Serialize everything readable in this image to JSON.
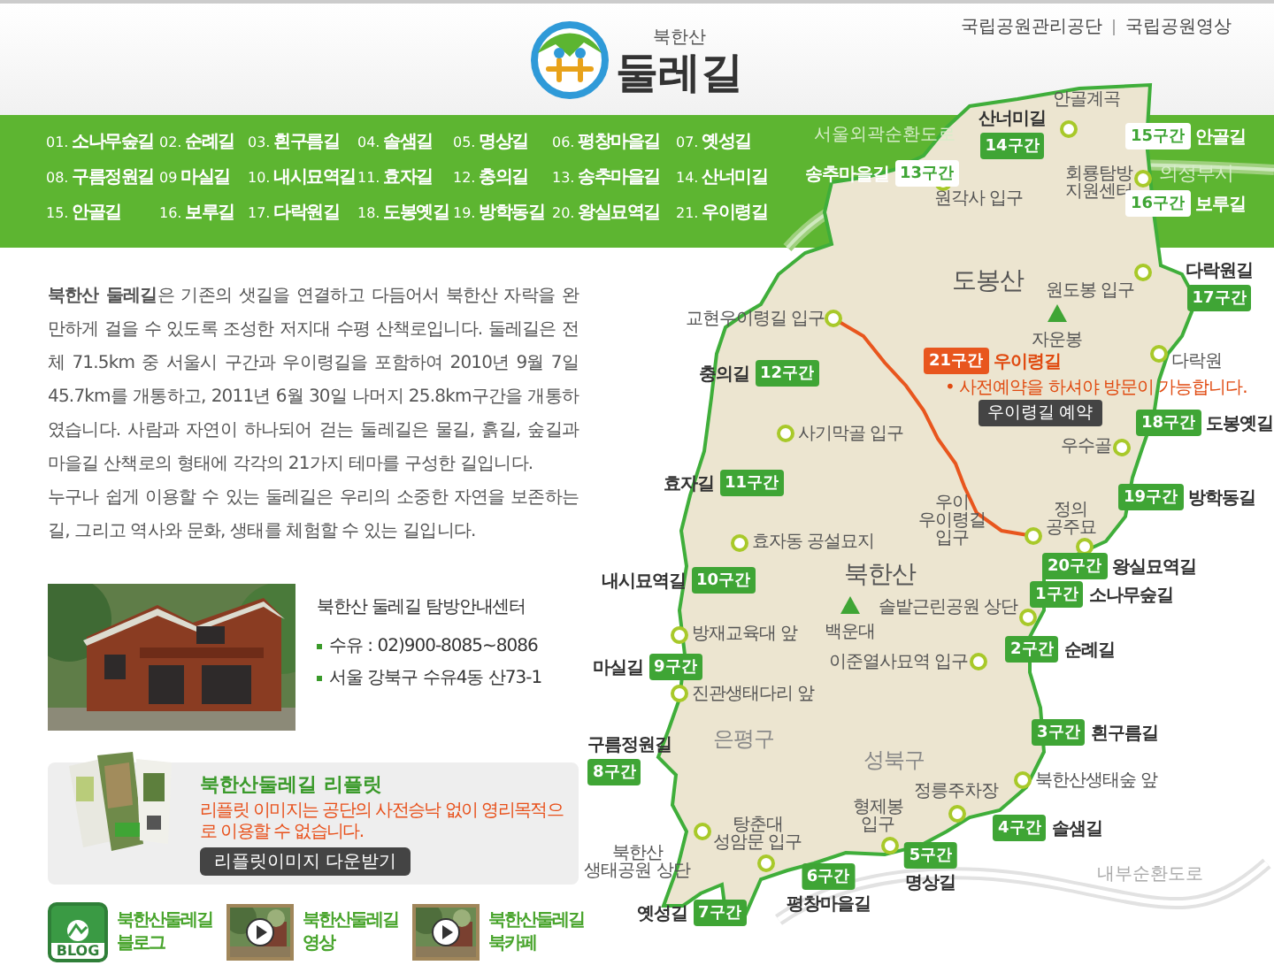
{
  "header": {
    "logo_small": "북한산",
    "logo_main": "둘레길",
    "links": [
      "국립공원관리공단",
      "국립공원영상"
    ]
  },
  "nav": [
    {
      "num": "01.",
      "name": "소나무숲길"
    },
    {
      "num": "02.",
      "name": "순례길"
    },
    {
      "num": "03.",
      "name": "흰구름길"
    },
    {
      "num": "04.",
      "name": "솔샘길"
    },
    {
      "num": "05.",
      "name": "명상길"
    },
    {
      "num": "06.",
      "name": "평창마을길"
    },
    {
      "num": "07.",
      "name": "옛성길"
    },
    {
      "num": "08.",
      "name": "구름정원길"
    },
    {
      "num": "09",
      "name": "마실길"
    },
    {
      "num": "10.",
      "name": "내시묘역길"
    },
    {
      "num": "11.",
      "name": "효자길"
    },
    {
      "num": "12.",
      "name": "충의길"
    },
    {
      "num": "13.",
      "name": "송추마을길"
    },
    {
      "num": "14.",
      "name": "산너미길"
    },
    {
      "num": "15.",
      "name": "안골길"
    },
    {
      "num": "16.",
      "name": "보루길"
    },
    {
      "num": "17.",
      "name": "다락원길"
    },
    {
      "num": "18.",
      "name": "도봉옛길"
    },
    {
      "num": "19.",
      "name": "방학동길"
    },
    {
      "num": "20.",
      "name": "왕실묘역길"
    },
    {
      "num": "21.",
      "name": "우이령길"
    }
  ],
  "intro": {
    "paragraphs": [
      "**북한산 둘레길**은 기존의 샛길을 연결하고 다듬어서 북한산 자락을 완만하게 걸을 수 있도록 조성한 저지대 수평 산책로입니다. 둘레길은 전체 71.5km 중 서울시 구간과 우이령길을 포함하여 2010년 9월 7일 45.7km를 개통하고, 2011년 6월 30일 나머지 25.8km구간을 개통하였습니다. 사람과 자연이 하나되어 걷는 둘레길은 물길, 흙길, 숲길과 마을길 산책로의 형태에 각각의 21가지 테마를 구성한 길입니다.",
      "누구나 쉽게 이용할 수 있는 둘레길은 우리의 소중한 자연을 보존하는 길, 그리고 역사와 문화, 생태를 체험할 수 있는 길입니다."
    ]
  },
  "center": {
    "title": "북한산 둘레길 탐방안내센터",
    "details": [
      "수유 : 02)900-8085~8086",
      "서울 강북구 수유4동 산73-1"
    ]
  },
  "leaflet": {
    "title": "북한산둘레길 리플릿",
    "notice": "리플릿 이미지는 공단의 사전승낙 없이 영리목적으로 이용할 수 없습니다.",
    "button": "리플릿이미지 다운받기"
  },
  "links": [
    {
      "kind": "blog",
      "badge": "BLOG",
      "lines": [
        "북한산둘레길",
        "블로그"
      ]
    },
    {
      "kind": "video",
      "lines": [
        "북한산둘레길",
        "영상"
      ]
    },
    {
      "kind": "video",
      "lines": [
        "북한산둘레길",
        "북카페"
      ]
    }
  ],
  "map": {
    "areas": [
      {
        "kind": "road",
        "text": "서울외곽순환도로"
      },
      {
        "kind": "city",
        "text": "의정부시"
      },
      {
        "kind": "mountain",
        "text": "도봉산"
      },
      {
        "kind": "peak",
        "text": "자운봉"
      },
      {
        "kind": "mountain",
        "text": "북한산"
      },
      {
        "kind": "peak",
        "text": "백운대"
      },
      {
        "kind": "district",
        "text": "은평구"
      },
      {
        "kind": "district",
        "text": "성북구"
      },
      {
        "kind": "road",
        "text": "내부순환도로"
      }
    ],
    "points": [
      {
        "text": "안골계곡"
      },
      {
        "text": "원각사 입구"
      },
      {
        "text": "회룡탐방\n지원센터"
      },
      {
        "text": "원도봉 입구"
      },
      {
        "text": "교현우이령길 입구"
      },
      {
        "text": "다락원"
      },
      {
        "text": "사기막골 입구"
      },
      {
        "text": "우이\n우이령길\n입구"
      },
      {
        "text": "정의\n공주묘"
      },
      {
        "text": "우수골"
      },
      {
        "text": "효자동 공설묘지"
      },
      {
        "text": "솔밭근린공원 상단"
      },
      {
        "text": "방재교육대 앞"
      },
      {
        "text": "이준열사묘역 입구"
      },
      {
        "text": "진관생태다리 앞"
      },
      {
        "text": "북한산생태숲 앞"
      },
      {
        "text": "정릉주차장"
      },
      {
        "text": "형제봉\n입구"
      },
      {
        "text": "탕춘대\n성암문 입구"
      },
      {
        "text": "북한산\n생태공원 상단"
      }
    ],
    "routes": [
      {
        "name": "산너미길",
        "badge": "14구간",
        "kind": "open"
      },
      {
        "name": "안골길",
        "badge": "15구간",
        "kind": "open"
      },
      {
        "name": "송추마을길",
        "badge": "13구간",
        "kind": "open"
      },
      {
        "name": "보루길",
        "badge": "16구간",
        "kind": "open"
      },
      {
        "name": "다락원길",
        "badge": "17구간",
        "kind": "open"
      },
      {
        "name": "충의길",
        "badge": "12구간",
        "kind": "open"
      },
      {
        "name": "우이령길",
        "badge": "21구간",
        "kind": "reserved"
      },
      {
        "name": "도봉옛길",
        "badge": "18구간",
        "kind": "open"
      },
      {
        "name": "효자길",
        "badge": "11구간",
        "kind": "open"
      },
      {
        "name": "방학동길",
        "badge": "19구간",
        "kind": "open"
      },
      {
        "name": "왕실묘역길",
        "badge": "20구간",
        "kind": "open"
      },
      {
        "name": "내시묘역길",
        "badge": "10구간",
        "kind": "open"
      },
      {
        "name": "소나무숲길",
        "badge": "1구간",
        "kind": "open"
      },
      {
        "name": "순례길",
        "badge": "2구간",
        "kind": "open"
      },
      {
        "name": "마실길",
        "badge": "9구간",
        "kind": "open"
      },
      {
        "name": "흰구름길",
        "badge": "3구간",
        "kind": "open"
      },
      {
        "name": "구름정원길",
        "badge": "8구간",
        "kind": "open"
      },
      {
        "name": "솔샘길",
        "badge": "4구간",
        "kind": "open"
      },
      {
        "name": "명상길",
        "badge": "5구간",
        "kind": "open"
      },
      {
        "name": "평창마을길",
        "badge": "6구간",
        "kind": "open"
      },
      {
        "name": "옛성길",
        "badge": "7구간",
        "kind": "open"
      }
    ],
    "reservation": {
      "notice": "• 사전예약을 하셔야 방문이 가능합니다.",
      "button": "우이령길 예약"
    }
  }
}
